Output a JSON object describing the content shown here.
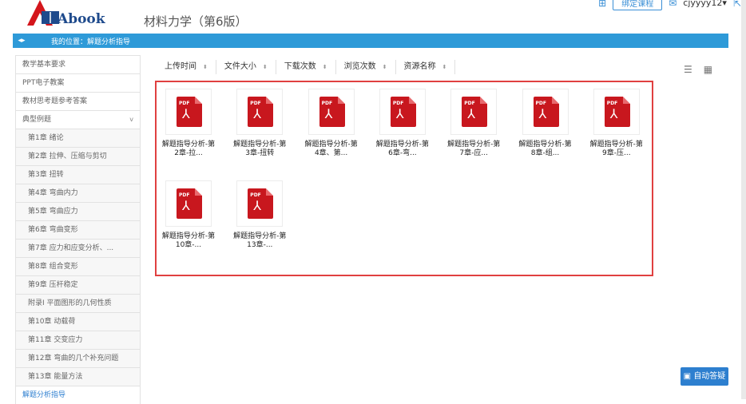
{
  "header": {
    "logo_text": "Abook",
    "book_title": "材料力学（第6版）",
    "bind_label": "绑定课程",
    "username": "cjyyyy12",
    "username_caret": "▾"
  },
  "breadcrumb": {
    "text": "我的位置：解题分析指导"
  },
  "sidebar": {
    "items": [
      {
        "label": "教学基本要求"
      },
      {
        "label": "PPT电子教案"
      },
      {
        "label": "教材思考题参考答案"
      },
      {
        "label": "典型例题"
      },
      {
        "label": "第1章 绪论"
      },
      {
        "label": "第2章 拉伸、压缩与剪切"
      },
      {
        "label": "第3章 扭转"
      },
      {
        "label": "第4章 弯曲内力"
      },
      {
        "label": "第5章 弯曲应力"
      },
      {
        "label": "第6章 弯曲变形"
      },
      {
        "label": "第7章 应力和应变分析、..."
      },
      {
        "label": "第8章 组合变形"
      },
      {
        "label": "第9章 压杆稳定"
      },
      {
        "label": "附录Ⅰ 平面图形的几何性质"
      },
      {
        "label": "第10章 动载荷"
      },
      {
        "label": "第11章 交变应力"
      },
      {
        "label": "第12章 弯曲的几个补充问题"
      },
      {
        "label": "第13章 能量方法"
      },
      {
        "label": "解题分析指导"
      }
    ],
    "caret": "v"
  },
  "sort": {
    "items": [
      {
        "label": "上传时间"
      },
      {
        "label": "文件大小"
      },
      {
        "label": "下载次数"
      },
      {
        "label": "浏览次数"
      },
      {
        "label": "资源名称"
      }
    ],
    "arrow": "⬍"
  },
  "files": [
    {
      "line1": "解题指导分析-第",
      "line2": "2章-拉..."
    },
    {
      "line1": "解题指导分析-第",
      "line2": "3章-扭转"
    },
    {
      "line1": "解题指导分析-第",
      "line2": "4章、第..."
    },
    {
      "line1": "解题指导分析-第",
      "line2": "6章-弯..."
    },
    {
      "line1": "解题指导分析-第",
      "line2": "7章-应..."
    },
    {
      "line1": "解题指导分析-第",
      "line2": "8章-组..."
    },
    {
      "line1": "解题指导分析-第",
      "line2": "9章-压..."
    },
    {
      "line1": "解题指导分析-第",
      "line2": "10章-..."
    },
    {
      "line1": "解题指导分析-第",
      "line2": "13章-..."
    }
  ],
  "pdf_badge": "PDF",
  "chat": {
    "label": "自动答疑"
  },
  "colors": {
    "accent": "#2e9ad8",
    "highlight_border": "#e04040",
    "pdf_red": "#c8171e"
  }
}
